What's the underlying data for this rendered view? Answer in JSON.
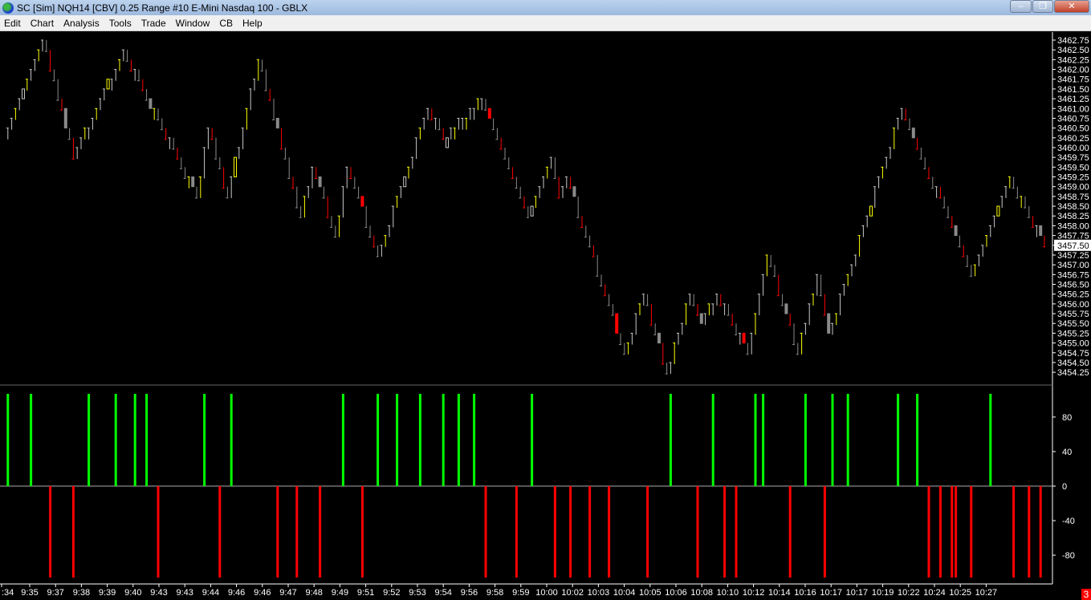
{
  "window": {
    "title": "SC [Sim] NQH14 [CBV]  0.25 Range  #10  E-Mini Nasdaq 100 - GBLX",
    "minimize": "–",
    "restore": "❐",
    "close": "✕"
  },
  "menu": [
    "Edit",
    "Chart",
    "Analysis",
    "Tools",
    "Trade",
    "Window",
    "CB",
    "Help"
  ],
  "status_badge": "3",
  "chart_data": {
    "type": "bar",
    "title": "NQH14 0.25 Range",
    "price_axis": {
      "min": 3454.25,
      "max": 3462.75,
      "step": 0.25,
      "current": "3457.50"
    },
    "time_labels": [
      ":34",
      "9:35",
      "9:37",
      "9:38",
      "9:39",
      "9:40",
      "9:43",
      "9:43",
      "9:44",
      "9:46",
      "9:46",
      "9:47",
      "9:48",
      "9:49",
      "9:51",
      "9:52",
      "9:53",
      "9:54",
      "9:56",
      "9:58",
      "9:59",
      "10:00",
      "10:02",
      "10:03",
      "10:04",
      "10:05",
      "10:06",
      "10:08",
      "10:10",
      "10:12",
      "10:14",
      "10:16",
      "10:17",
      "10:17",
      "10:19",
      "10:22",
      "10:24",
      "10:25",
      "10:27"
    ],
    "price_pivots": [
      [
        1,
        3460.25
      ],
      [
        11,
        3462.75
      ],
      [
        19,
        3459.75
      ],
      [
        32,
        3462.5
      ],
      [
        51,
        3458.75
      ],
      [
        54,
        3460.5
      ],
      [
        59,
        3458.75
      ],
      [
        67,
        3462.25
      ],
      [
        78,
        3458.25
      ],
      [
        81,
        3459.5
      ],
      [
        87,
        3457.75
      ],
      [
        90,
        3459.5
      ],
      [
        98,
        3457.25
      ],
      [
        111,
        3461
      ],
      [
        115,
        3460.25
      ],
      [
        125,
        3461.25
      ],
      [
        137,
        3458.25
      ],
      [
        143,
        3459.75
      ],
      [
        145,
        3458.75
      ],
      [
        147,
        3459.25
      ],
      [
        162,
        3454.75
      ],
      [
        167,
        3456.25
      ],
      [
        173,
        3454.25
      ],
      [
        179,
        3456.25
      ],
      [
        182,
        3455.5
      ],
      [
        186,
        3456.25
      ],
      [
        194,
        3454.75
      ],
      [
        199,
        3457.25
      ],
      [
        207,
        3454.75
      ],
      [
        212,
        3456.75
      ],
      [
        215,
        3455.25
      ],
      [
        234,
        3461
      ],
      [
        252,
        3456.75
      ],
      [
        262,
        3459.25
      ],
      [
        271,
        3457.5
      ]
    ],
    "indicator": {
      "ticks": [
        "80",
        "40",
        "0",
        "-40",
        "-80"
      ],
      "range": [
        -105,
        105
      ],
      "positive_bars": [
        1,
        7,
        22,
        29,
        34,
        37,
        52,
        59,
        88,
        97,
        102,
        108,
        114,
        118,
        122,
        137,
        173,
        184,
        195,
        197,
        208,
        215,
        219,
        232,
        237,
        256
      ],
      "negative_bars": [
        12,
        18,
        40,
        56,
        71,
        76,
        82,
        93,
        125,
        133,
        143,
        147,
        152,
        157,
        167,
        180,
        187,
        190,
        204,
        213,
        240,
        243,
        246,
        247,
        251,
        262,
        266,
        269
      ],
      "value": 100
    },
    "colors": {
      "up": "#ffff00",
      "down": "#ff0000",
      "up_alt": "#c8c8c8",
      "down_alt": "#8a8a8a",
      "positive": "#00ff00",
      "negative": "#ff0000"
    }
  }
}
